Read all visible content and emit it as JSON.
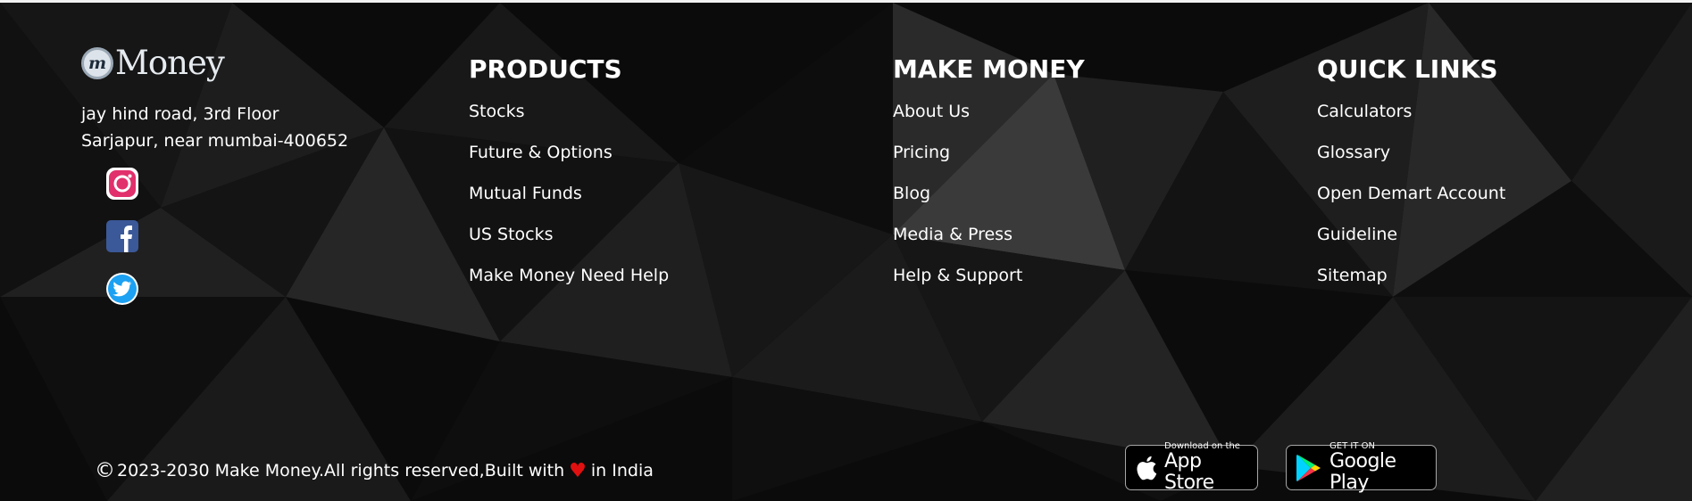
{
  "brand": {
    "badge_letter": "m",
    "name": "Money"
  },
  "address": {
    "line1": "jay hind road, 3rd Floor",
    "line2": "Sarjapur, near mumbai-400652"
  },
  "social": [
    {
      "name": "instagram-icon",
      "color": "#e1306c"
    },
    {
      "name": "facebook-icon",
      "color": "#3b5998"
    },
    {
      "name": "twitter-icon",
      "color": "#1da1f2"
    }
  ],
  "columns": [
    {
      "title": "PRODUCTS",
      "links": [
        "Stocks",
        "Future & Options",
        "Mutual Funds",
        "US Stocks",
        "Make Money Need Help"
      ]
    },
    {
      "title": "MAKE MONEY",
      "links": [
        "About Us",
        "Pricing",
        "Blog",
        "Media & Press",
        "Help & Support"
      ]
    },
    {
      "title": "QUICK LINKS",
      "links": [
        "Calculators",
        "Glossary",
        "Open Demart Account",
        "Guideline",
        "Sitemap"
      ]
    }
  ],
  "copyright": {
    "symbol": "©",
    "text_before": "2023-2030 Make Money.All rights reserved,Built with",
    "heart": "♥",
    "text_after": "in India"
  },
  "app_store": {
    "small": "Download on the",
    "big": "App Store"
  },
  "google_play": {
    "small": "GET IT ON",
    "big": "Google Play"
  },
  "colors": {
    "background": "#0a0a0a",
    "text": "#ffffff",
    "heart": "#e11010"
  }
}
